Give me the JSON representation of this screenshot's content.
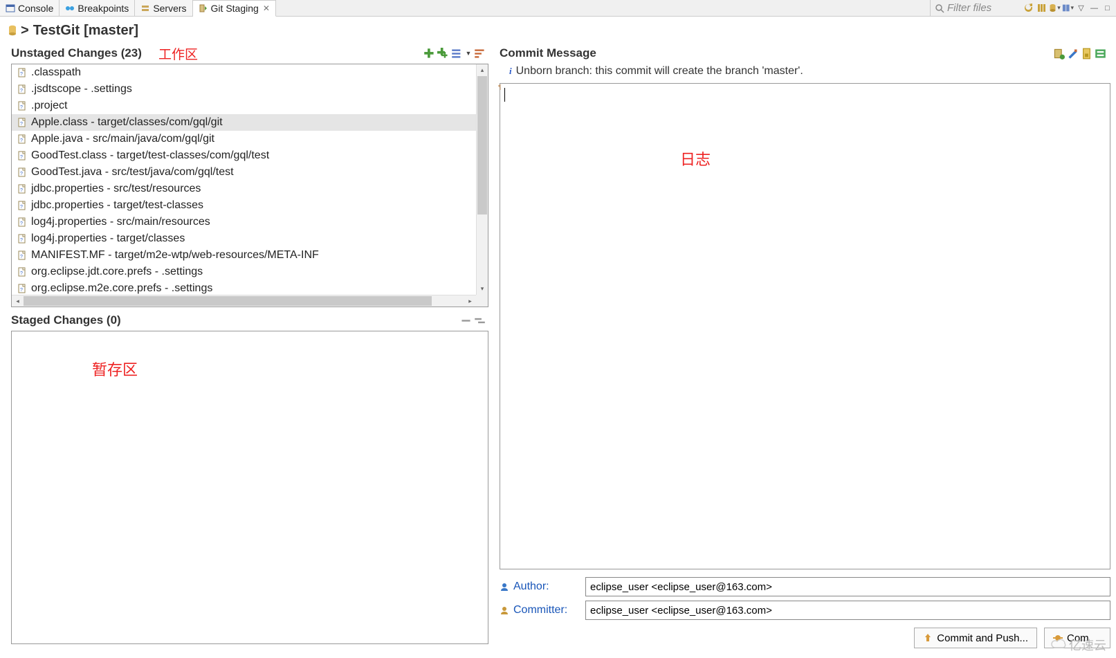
{
  "tabs": {
    "items": [
      {
        "label": "Console"
      },
      {
        "label": "Breakpoints"
      },
      {
        "label": "Servers"
      },
      {
        "label": "Git Staging"
      }
    ],
    "filter_placeholder": "Filter files"
  },
  "repo": {
    "prefix": ">",
    "name": "TestGit",
    "branch": "[master]"
  },
  "unstaged": {
    "header": "Unstaged Changes (23)",
    "annotation": "工作区",
    "files": [
      {
        "name": ".classpath",
        "path": ""
      },
      {
        "name": ".jsdtscope",
        "path": " - .settings"
      },
      {
        "name": ".project",
        "path": ""
      },
      {
        "name": "Apple.class",
        "path": " - target/classes/com/gql/git"
      },
      {
        "name": "Apple.java",
        "path": " - src/main/java/com/gql/git"
      },
      {
        "name": "GoodTest.class",
        "path": " - target/test-classes/com/gql/test"
      },
      {
        "name": "GoodTest.java",
        "path": " - src/test/java/com/gql/test"
      },
      {
        "name": "jdbc.properties",
        "path": " - src/test/resources"
      },
      {
        "name": "jdbc.properties",
        "path": " - target/test-classes"
      },
      {
        "name": "log4j.properties",
        "path": " - src/main/resources"
      },
      {
        "name": "log4j.properties",
        "path": " - target/classes"
      },
      {
        "name": "MANIFEST.MF",
        "path": " - target/m2e-wtp/web-resources/META-INF"
      },
      {
        "name": "org.eclipse.jdt.core.prefs",
        "path": " - .settings"
      },
      {
        "name": "org.eclipse.m2e.core.prefs",
        "path": " - .settings"
      }
    ],
    "selected_index": 3
  },
  "staged": {
    "header": "Staged Changes (0)",
    "annotation": "暂存区"
  },
  "commit": {
    "header": "Commit Message",
    "info": "Unborn branch: this commit will create the branch 'master'.",
    "annotation": "日志",
    "author_label": "Author:",
    "committer_label": "Committer:",
    "author_value": "eclipse_user <eclipse_user@163.com>",
    "committer_value": "eclipse_user <eclipse_user@163.com>",
    "commit_push": "Commit and Push...",
    "commit": "Com"
  },
  "watermark": "亿速云"
}
